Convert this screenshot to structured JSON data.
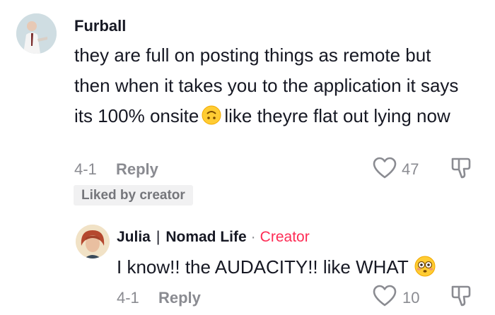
{
  "comment": {
    "username": "Furball",
    "text_part1": "they are full on posting things as remote but then when it takes you to the application it says its 100% onsite",
    "text_part2": "like theyre flat out lying now",
    "emoji_icon": "upside-down-face-emoji",
    "date": "4-1",
    "reply_label": "Reply",
    "like_count": "47",
    "liked_badge": "Liked by creator"
  },
  "reply": {
    "username": "Julia",
    "separator": "|",
    "channel": "Nomad Life",
    "dot": "·",
    "creator_badge": "Creator",
    "text": "I know!! the AUDACITY!! like WHAT",
    "emoji_icon": "flushed-face-emoji",
    "date": "4-1",
    "reply_label": "Reply",
    "like_count": "10"
  },
  "colors": {
    "text": "#161823",
    "meta": "#8a8b91",
    "creator": "#fe2c55",
    "badge_bg": "#f1f1f2"
  }
}
